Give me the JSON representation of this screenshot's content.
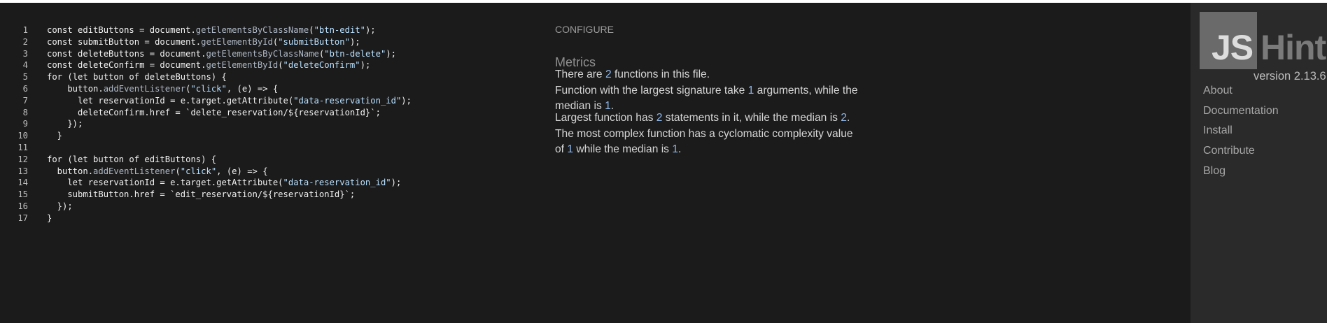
{
  "editor": {
    "lines": [
      {
        "n": "1",
        "tokens": [
          [
            "kw",
            "const "
          ],
          [
            "plain",
            "editButtons = document."
          ],
          [
            "fn",
            "getElementsByClassName"
          ],
          [
            "plain",
            "("
          ],
          [
            "str",
            "\"btn-edit\""
          ],
          [
            "plain",
            ");"
          ]
        ]
      },
      {
        "n": "2",
        "tokens": [
          [
            "kw",
            "const "
          ],
          [
            "plain",
            "submitButton = document."
          ],
          [
            "fn",
            "getElementById"
          ],
          [
            "plain",
            "("
          ],
          [
            "str",
            "\"submitButton\""
          ],
          [
            "plain",
            ");"
          ]
        ]
      },
      {
        "n": "3",
        "tokens": [
          [
            "kw",
            "const "
          ],
          [
            "plain",
            "deleteButtons = document."
          ],
          [
            "fn",
            "getElementsByClassName"
          ],
          [
            "plain",
            "("
          ],
          [
            "str",
            "\"btn-delete\""
          ],
          [
            "plain",
            ");"
          ]
        ]
      },
      {
        "n": "4",
        "tokens": [
          [
            "kw",
            "const "
          ],
          [
            "plain",
            "deleteConfirm = document."
          ],
          [
            "fn",
            "getElementById"
          ],
          [
            "plain",
            "("
          ],
          [
            "str",
            "\"deleteConfirm\""
          ],
          [
            "plain",
            ");"
          ]
        ]
      },
      {
        "n": "5",
        "tokens": [
          [
            "kw",
            "for "
          ],
          [
            "plain",
            "(let button of deleteButtons) {"
          ]
        ]
      },
      {
        "n": "6",
        "tokens": [
          [
            "plain",
            "    button."
          ],
          [
            "fn",
            "addEventListener"
          ],
          [
            "plain",
            "("
          ],
          [
            "str",
            "\"click\""
          ],
          [
            "plain",
            ", (e) => {"
          ]
        ]
      },
      {
        "n": "7",
        "tokens": [
          [
            "plain",
            "      let reservationId = e.target.getAttribute("
          ],
          [
            "str",
            "\"data-reservation_id\""
          ],
          [
            "plain",
            ");"
          ]
        ]
      },
      {
        "n": "8",
        "tokens": [
          [
            "plain",
            "      deleteConfirm.href = `delete_reservation/${reservationId}`;"
          ]
        ]
      },
      {
        "n": "9",
        "tokens": [
          [
            "plain",
            "    });"
          ]
        ]
      },
      {
        "n": "10",
        "tokens": [
          [
            "plain",
            "  }"
          ]
        ]
      },
      {
        "n": "11",
        "tokens": [
          [
            "plain",
            ""
          ]
        ]
      },
      {
        "n": "12",
        "tokens": [
          [
            "kw",
            "for "
          ],
          [
            "plain",
            "(let button of editButtons) {"
          ]
        ]
      },
      {
        "n": "13",
        "tokens": [
          [
            "plain",
            "  button."
          ],
          [
            "fn",
            "addEventListener"
          ],
          [
            "plain",
            "("
          ],
          [
            "str",
            "\"click\""
          ],
          [
            "plain",
            ", (e) => {"
          ]
        ]
      },
      {
        "n": "14",
        "tokens": [
          [
            "plain",
            "    let reservationId = e.target.getAttribute("
          ],
          [
            "str",
            "\"data-reservation_id\""
          ],
          [
            "plain",
            ");"
          ]
        ]
      },
      {
        "n": "15",
        "tokens": [
          [
            "plain",
            "    submitButton.href = `edit_reservation/${reservationId}`;"
          ]
        ]
      },
      {
        "n": "16",
        "tokens": [
          [
            "plain",
            "  });"
          ]
        ]
      },
      {
        "n": "17",
        "tokens": [
          [
            "plain",
            "}"
          ]
        ]
      }
    ]
  },
  "report": {
    "configure_label": "CONFIGURE",
    "metrics_title": "Metrics",
    "metrics": [
      [
        [
          "t",
          "There are "
        ],
        [
          "n",
          "2"
        ],
        [
          "t",
          " functions in this file."
        ]
      ],
      [
        [
          "t",
          "Function with the largest signature take "
        ],
        [
          "n",
          "1"
        ],
        [
          "t",
          " arguments, while the median is "
        ],
        [
          "n",
          "1"
        ],
        [
          "t",
          "."
        ]
      ],
      [
        [
          "t",
          "Largest function has "
        ],
        [
          "n",
          "2"
        ],
        [
          "t",
          " statements in it, while the median is "
        ],
        [
          "n",
          "2"
        ],
        [
          "t",
          "."
        ]
      ],
      [
        [
          "t",
          "The most complex function has a cyclomatic complexity value of "
        ],
        [
          "n",
          "1"
        ],
        [
          "t",
          " while the median is "
        ],
        [
          "n",
          "1"
        ],
        [
          "t",
          "."
        ]
      ]
    ]
  },
  "sidebar": {
    "logo_js": "JS",
    "logo_hint": "Hint",
    "version": "version 2.13.6",
    "nav": [
      "About",
      "Documentation",
      "Install",
      "Contribute",
      "Blog"
    ]
  },
  "colors": {
    "background": "#1b1b1b",
    "sidebar_bg": "#2a2a2a",
    "number_accent": "#8fb6e8",
    "string_token": "#b8e0ff"
  }
}
